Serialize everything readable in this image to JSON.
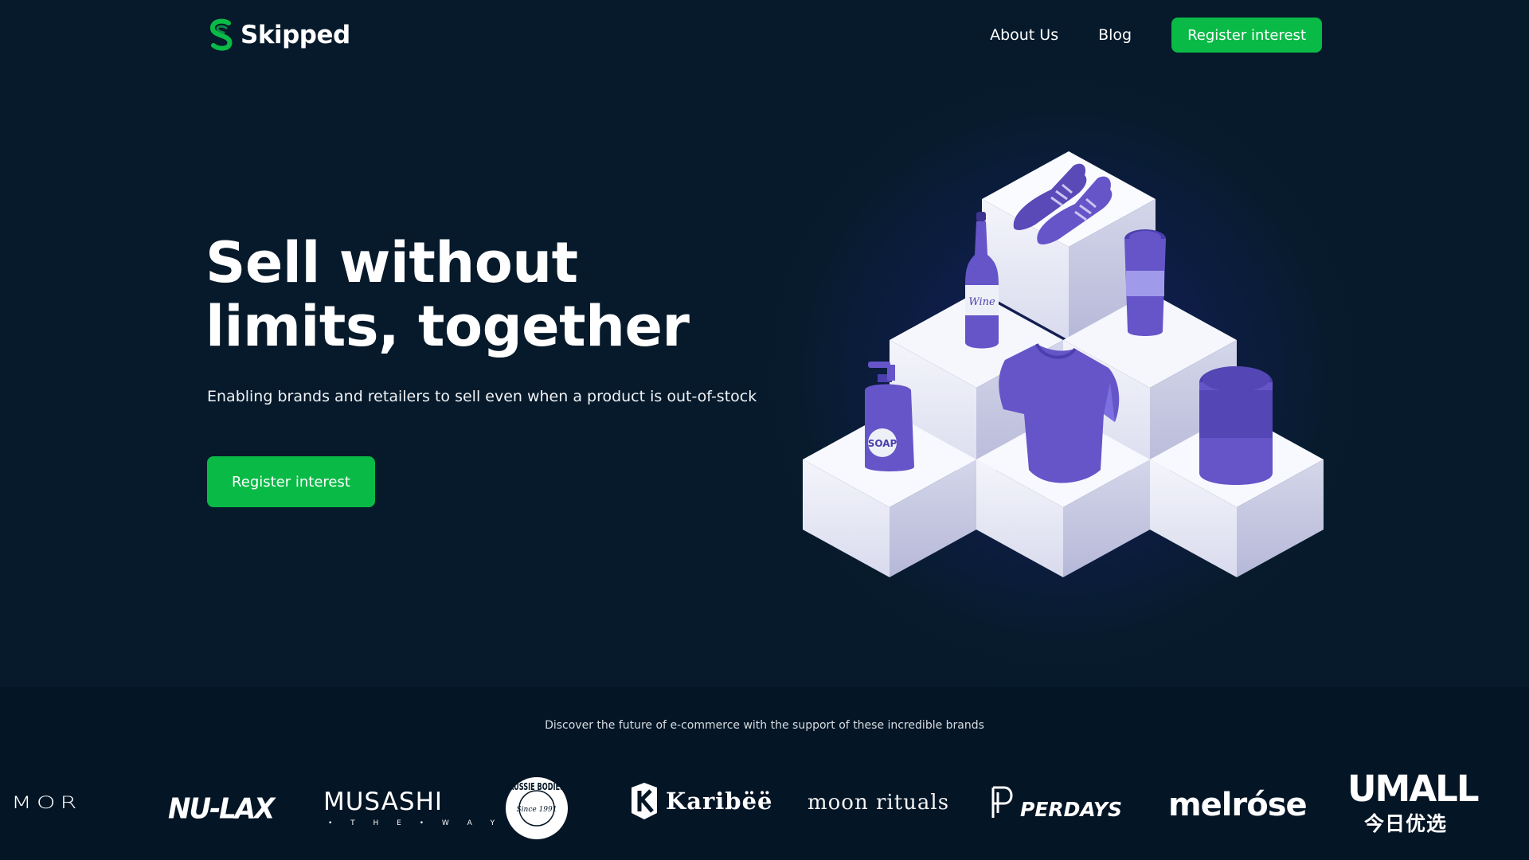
{
  "header": {
    "logo_text": "Skipped",
    "nav": [
      {
        "label": "About Us"
      },
      {
        "label": "Blog"
      }
    ],
    "cta_label": "Register interest"
  },
  "hero": {
    "headline_line1": "Sell without",
    "headline_line2": "limits, together",
    "subline": "Enabling brands and retailers to sell even when a product is out-of-stock",
    "cta_label": "Register interest",
    "illustration_labels": {
      "wine": "Wine",
      "soap": "SOAP"
    }
  },
  "brands": {
    "caption": "Discover the future of e-commerce with the support of these incredible brands",
    "logos": [
      {
        "name": "MOR"
      },
      {
        "name": "NU-LAX"
      },
      {
        "name": "MUSASHI",
        "sub": "• T H E • W A Y •"
      },
      {
        "name": "AUSSIE BODIES",
        "sub": "Since 1991"
      },
      {
        "name": "Karibëë"
      },
      {
        "name": "moon rituals"
      },
      {
        "name": "PERDAYS"
      },
      {
        "name": "melróse"
      },
      {
        "name": "UMALL",
        "sub": "今日优选"
      }
    ]
  },
  "colors": {
    "background": "#061a2b",
    "accent_green": "#0aba46",
    "product_purple": "#6555c9",
    "cube_white": "#eef0f8"
  },
  "icons": {
    "logo": "skipped-s-logo-icon"
  }
}
